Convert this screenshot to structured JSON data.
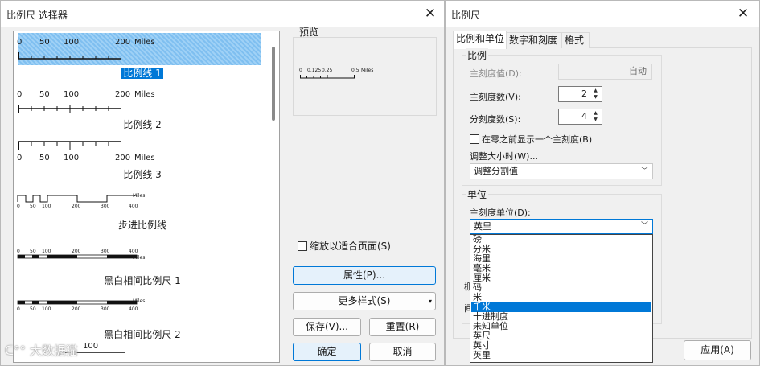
{
  "selector": {
    "title": "比例尺 选择器",
    "close": "✕",
    "preview_label": "预览",
    "items": [
      {
        "name": "比例线 1",
        "ticks": [
          "0",
          "50",
          "100",
          "200"
        ],
        "unit": "Miles"
      },
      {
        "name": "比例线 2",
        "ticks": [
          "0",
          "50",
          "100",
          "200"
        ],
        "unit": "Miles"
      },
      {
        "name": "比例线 3",
        "ticks": [
          "0",
          "50",
          "100",
          "200"
        ],
        "unit": "Miles"
      },
      {
        "name": "步进比例线",
        "ticks": [
          "0",
          "50",
          "100",
          "200",
          "300",
          "400"
        ],
        "unit": "Miles"
      },
      {
        "name": "黑白相间比例尺 1",
        "ticks": [
          "0",
          "50",
          "100",
          "200",
          "300",
          "400"
        ],
        "unit": "Miles"
      },
      {
        "name": "黑白相间比例尺 2",
        "ticks": [
          "0",
          "50",
          "100",
          "200",
          "300",
          "400"
        ],
        "unit": "Miles"
      }
    ],
    "partial_tick": "100",
    "preview": {
      "ticks": [
        "0",
        "0.125",
        "0.25",
        "0.5"
      ],
      "unit": "Miles"
    },
    "fit_page_label": "缩放以适合页面(S)",
    "fit_page_checked": false,
    "properties_button": "属性(P)...",
    "more_styles_button": "更多样式(S)",
    "save_button": "保存(V)...",
    "reset_button": "重置(R)",
    "ok_button": "确定",
    "cancel_button": "取消"
  },
  "props": {
    "title": "比例尺",
    "close": "✕",
    "tabs": [
      {
        "label": "比例和单位",
        "active": true
      },
      {
        "label": "数字和刻度",
        "active": false
      },
      {
        "label": "格式",
        "active": false
      }
    ],
    "scale_group": "比例",
    "division_value_label": "主刻度值(D):",
    "division_value": "自动",
    "divisions_label": "主刻度数(V):",
    "divisions": "2",
    "subdivisions_label": "分刻度数(S):",
    "subdivisions": "4",
    "show_before_zero_label": "在零之前显示一个主刻度(B)",
    "show_before_zero_checked": false,
    "resize_label": "调整大小时(W)...",
    "resize_value": "调整分割值",
    "units_group": "单位",
    "division_units_label": "主刻度单位(D):",
    "division_units_value": "英里",
    "unit_options": [
      "磅",
      "分米",
      "海里",
      "毫米",
      "厘米",
      "码",
      "米",
      "千米",
      "十进制度",
      "未知单位",
      "英尺",
      "英寸",
      "英里"
    ],
    "highlighted_option": "千米",
    "hidden_peek_1": "栅",
    "hidden_peek_2": "间",
    "apply_button": "应用(A)"
  },
  "watermark": "大数据猫"
}
